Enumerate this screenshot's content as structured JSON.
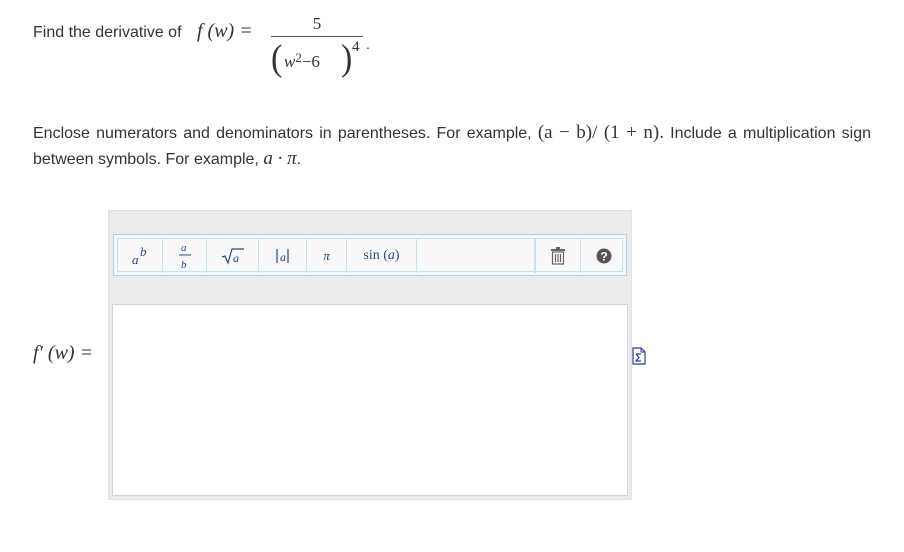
{
  "question": {
    "prompt": "Find the derivative of",
    "function_lhs": "f (w) =",
    "numerator": "5",
    "denominator_base": "w",
    "denominator_inner_exp": "2",
    "denominator_rest": "−6",
    "denominator_outer_exp": "4",
    "trailing": "."
  },
  "instructions": {
    "part1": "Enclose numerators and denominators in parentheses. For example, ",
    "example1": "(a − b)/ (1 + n).",
    "part2": " Include a multiplication sign between symbols. For example, ",
    "example2": "a · π",
    "part3": "."
  },
  "answer": {
    "label": "f′ (w) =",
    "value": ""
  },
  "toolbar": {
    "buttons": [
      {
        "name": "exponent",
        "label": "ab"
      },
      {
        "name": "fraction",
        "label": "a/b"
      },
      {
        "name": "sqrt",
        "label": "√a"
      },
      {
        "name": "abs",
        "label": "|a|"
      },
      {
        "name": "pi",
        "label": "π"
      },
      {
        "name": "sin",
        "label": "sin (a)"
      },
      {
        "name": "trash",
        "label": "trash-icon"
      },
      {
        "name": "help",
        "label": "?"
      }
    ]
  },
  "colors": {
    "toolbar_border": "#a9d5e8",
    "editor_bg": "#ebebeb",
    "icon_blue": "#2a4a7a"
  }
}
